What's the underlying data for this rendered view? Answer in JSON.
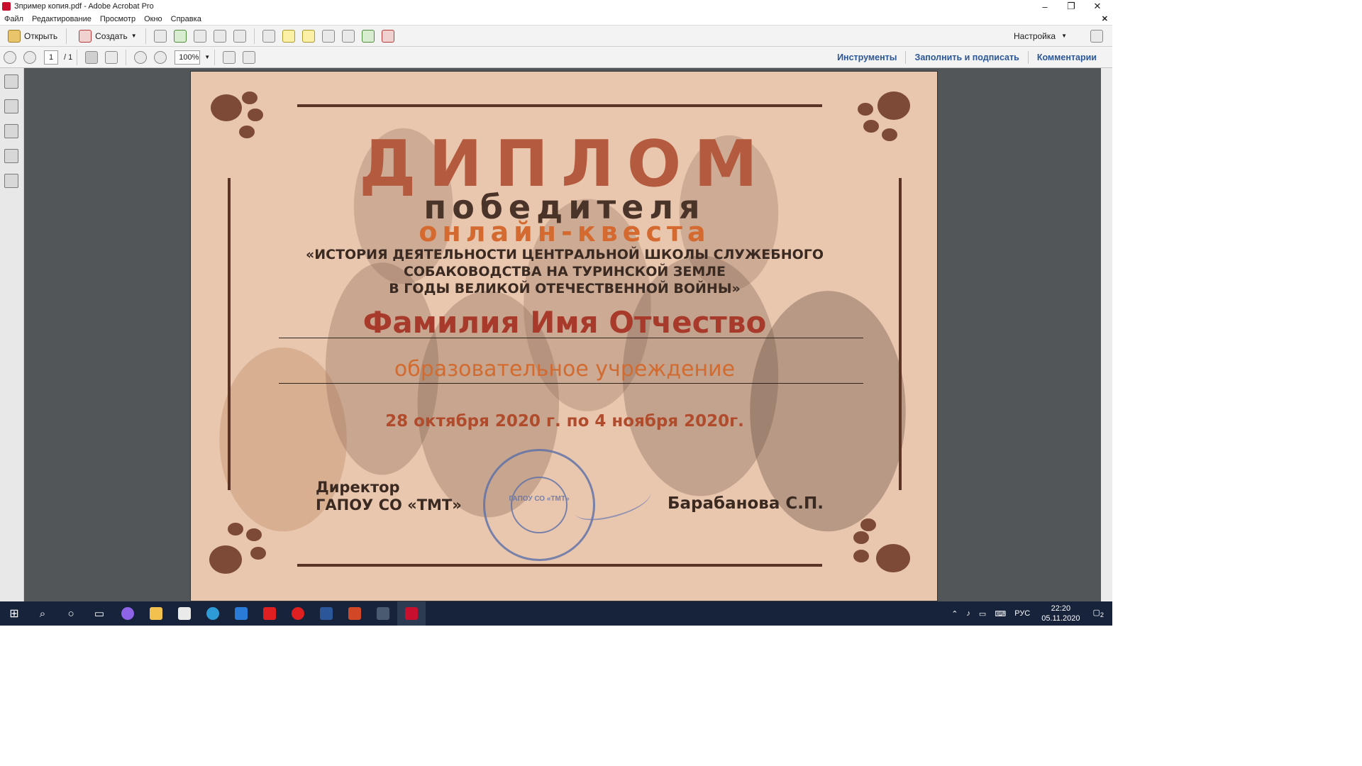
{
  "window": {
    "title": "Зпример копия.pdf - Adobe Acrobat Pro",
    "minimize": "–",
    "maximize": "❐",
    "close": "✕"
  },
  "menu": {
    "items": [
      "Файл",
      "Редактирование",
      "Просмотр",
      "Окно",
      "Справка"
    ],
    "close_doc": "✕"
  },
  "toolbar": {
    "open_label": "Открыть",
    "create_label": "Создать",
    "customize_label": "Настройка"
  },
  "nav": {
    "page_current": "1",
    "page_total": "/ 1",
    "zoom": "100%"
  },
  "panels": {
    "tools": "Инструменты",
    "fill_sign": "Заполнить и подписать",
    "comments": "Комментарии"
  },
  "document": {
    "title": "ДИПЛОМ",
    "subtitle": "победителя",
    "quest": "онлайн-квеста",
    "subject_lines": [
      "«ИСТОРИЯ ДЕЯТЕЛЬНОСТИ ЦЕНТРАЛЬНОЙ ШКОЛЫ СЛУЖЕБНОГО",
      "СОБАКОВОДСТВА НА ТУРИНСКОЙ ЗЕМЛЕ",
      "В ГОДЫ ВЕЛИКОЙ ОТЕЧЕСТВЕННОЙ ВОЙНЫ»"
    ],
    "recipient": "Фамилия Имя Отчество",
    "organization": "образовательное учреждение",
    "dates": "28 октября 2020 г. по 4 ноября 2020г.",
    "director_title": [
      "Директор",
      "ГАПОУ СО «ТМТ»"
    ],
    "signer": "Барабанова С.П.",
    "stamp_text": "ГАПОУ СО «ТМТ»"
  },
  "taskbar": {
    "lang": "РУС",
    "time": "22:20",
    "date": "05.11.2020",
    "notifications": "2"
  }
}
